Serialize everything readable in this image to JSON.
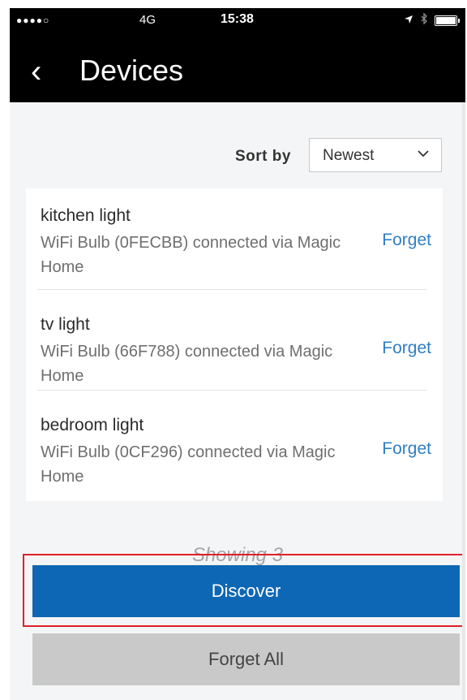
{
  "status_bar": {
    "signal": "●●●●○",
    "network": "4G",
    "time": "15:38"
  },
  "header": {
    "back_icon": "‹",
    "title": "Devices"
  },
  "sort": {
    "label": "Sort by",
    "selected": "Newest"
  },
  "devices": [
    {
      "name": "kitchen light",
      "description": "WiFi Bulb (0FECBB) connected via Magic Home",
      "action": "Forget"
    },
    {
      "name": "tv light",
      "description": "WiFi Bulb (66F788) connected via Magic Home",
      "action": "Forget"
    },
    {
      "name": "bedroom light",
      "description": "WiFi Bulb (0CF296) connected via Magic Home",
      "action": "Forget"
    }
  ],
  "showing_text": "Showing 3",
  "buttons": {
    "discover": "Discover",
    "forget_all": "Forget All"
  },
  "colors": {
    "header_bg": "#000000",
    "link": "#2f7fc4",
    "primary_button": "#0e67b4",
    "secondary_button": "#c9c9c9",
    "highlight_border": "#e0202a"
  }
}
